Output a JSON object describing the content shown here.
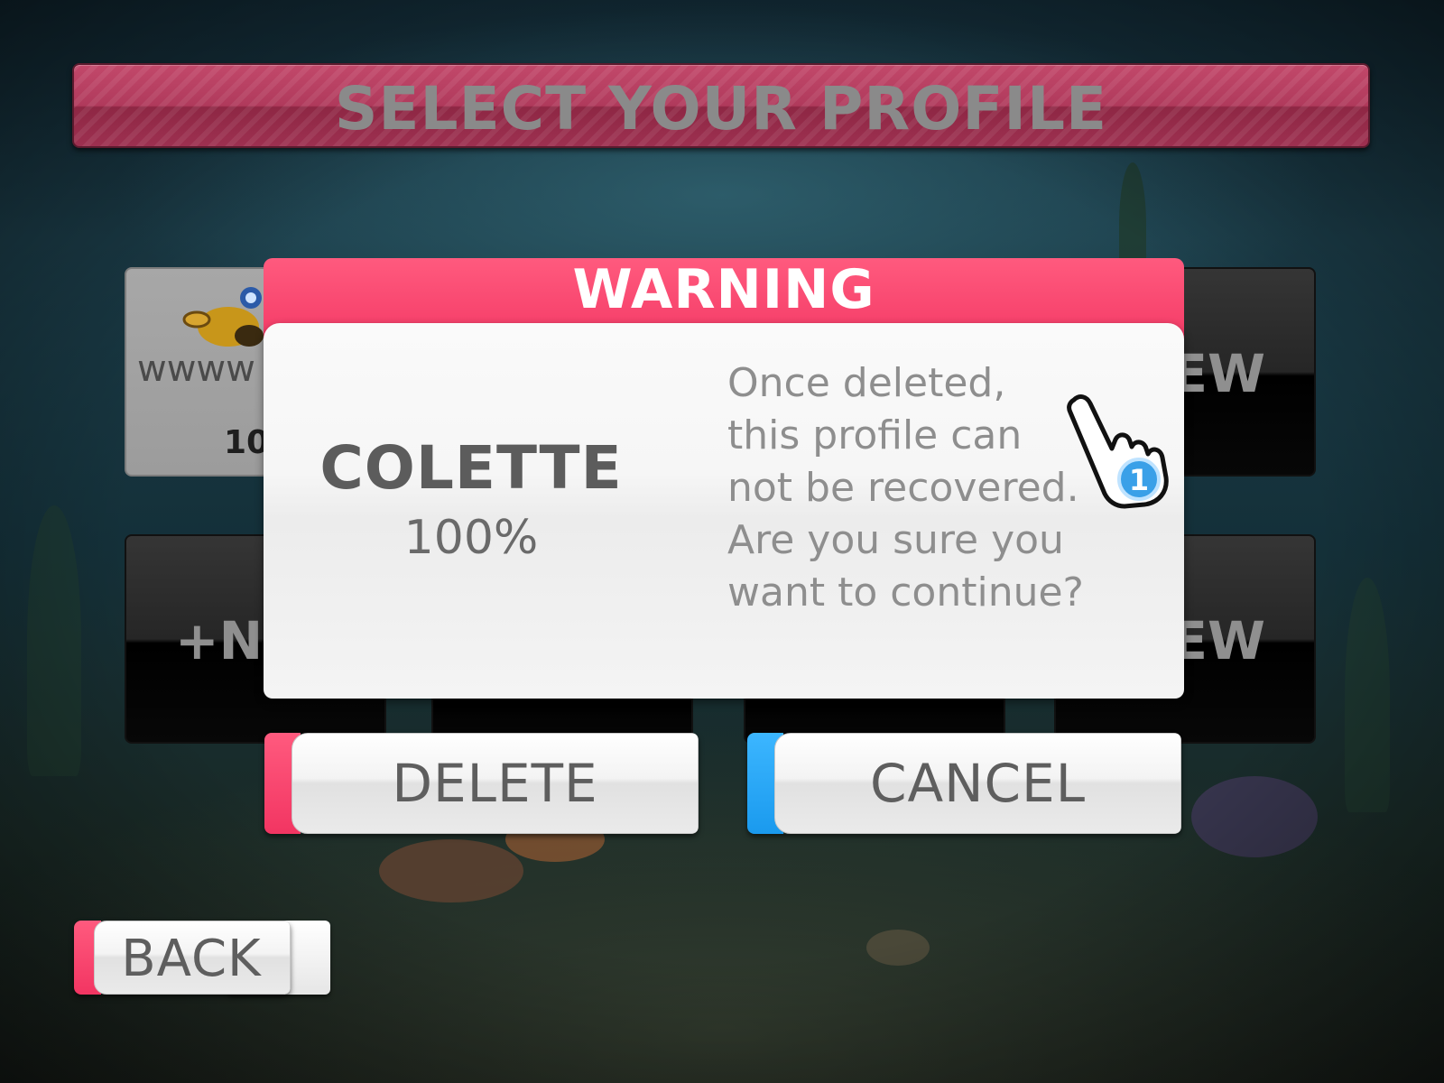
{
  "screen": {
    "title": "SELECT YOUR PROFILE"
  },
  "profiles": {
    "slot1": {
      "name": "wwww",
      "progress": "100%"
    },
    "slot2_label": "NEW",
    "slot3_label": "+NEW",
    "slot4_label": "NEW"
  },
  "dialog": {
    "title": "WARNING",
    "profile_name": "COLETTE",
    "profile_progress": "100%",
    "message": "Once deleted, this profile can not be recovered. Are you sure you want to continue?",
    "delete_label": "DELETE",
    "cancel_label": "CANCEL"
  },
  "back_label": "BACK",
  "back_ghost_label": "K",
  "cursor": {
    "badge": "1"
  },
  "colors": {
    "accent_pink": "#f23562",
    "accent_blue": "#1a9aee",
    "title_bar": "#b03a5c"
  },
  "icons": {
    "profile_avatar": "submarine-icon",
    "pointer": "hand-pointer-icon"
  }
}
